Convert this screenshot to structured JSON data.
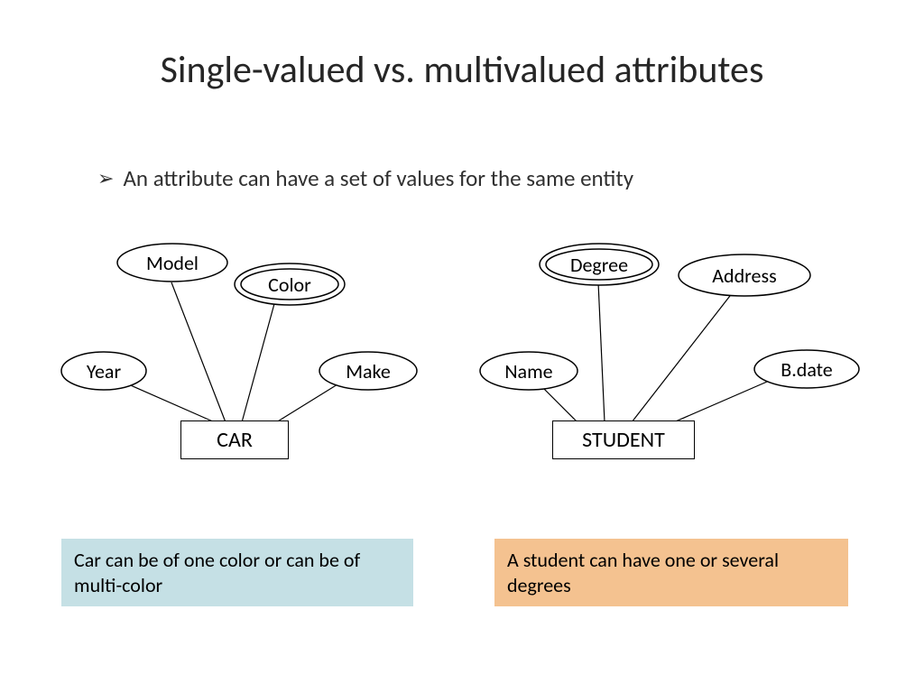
{
  "title": "Single-valued vs. multivalued attributes",
  "bullet": "An attribute can have a set of values for the same entity",
  "diagram": {
    "left": {
      "entity": "CAR",
      "attributes": {
        "year": "Year",
        "model": "Model",
        "color": "Color",
        "make": "Make"
      },
      "caption": "Car can be of one color or can be of multi-color"
    },
    "right": {
      "entity": "STUDENT",
      "attributes": {
        "name": "Name",
        "degree": "Degree",
        "address": "Address",
        "bdate": "B.date"
      },
      "caption": "A student can have one or several degrees"
    }
  }
}
